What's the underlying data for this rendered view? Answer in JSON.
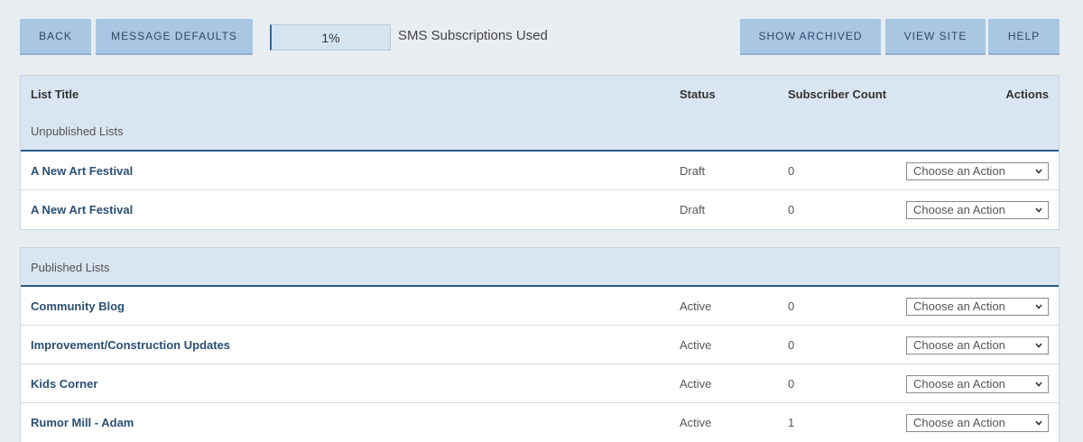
{
  "toolbar": {
    "back_label": "BACK",
    "message_defaults_label": "MESSAGE DEFAULTS",
    "usage_value": "1%",
    "usage_label": "SMS Subscriptions Used",
    "show_archived_label": "SHOW ARCHIVED",
    "view_site_label": "VIEW SITE",
    "help_label": "HELP"
  },
  "columns": {
    "title": "List Title",
    "status": "Status",
    "count": "Subscriber Count",
    "actions": "Actions"
  },
  "unpublished": {
    "label": "Unpublished Lists",
    "rows": [
      {
        "title": "A New Art Festival",
        "status": "Draft",
        "count": "0",
        "action": "Choose an Action"
      },
      {
        "title": "A New Art Festival",
        "status": "Draft",
        "count": "0",
        "action": "Choose an Action"
      }
    ]
  },
  "published": {
    "label": "Published Lists",
    "rows": [
      {
        "title": "Community Blog",
        "status": "Active",
        "count": "0",
        "action": "Choose an Action"
      },
      {
        "title": "Improvement/Construction Updates",
        "status": "Active",
        "count": "0",
        "action": "Choose an Action"
      },
      {
        "title": "Kids Corner",
        "status": "Active",
        "count": "0",
        "action": "Choose an Action"
      },
      {
        "title": "Rumor Mill - Adam",
        "status": "Active",
        "count": "1",
        "action": "Choose an Action"
      }
    ]
  },
  "icons": {
    "select_arrow": "chevron-down-icon"
  },
  "colors": {
    "button_bg": "#a9c6e3",
    "header_bg": "#d9e5f0",
    "link": "#2b4f74",
    "accent_border": "#2b5b87"
  }
}
